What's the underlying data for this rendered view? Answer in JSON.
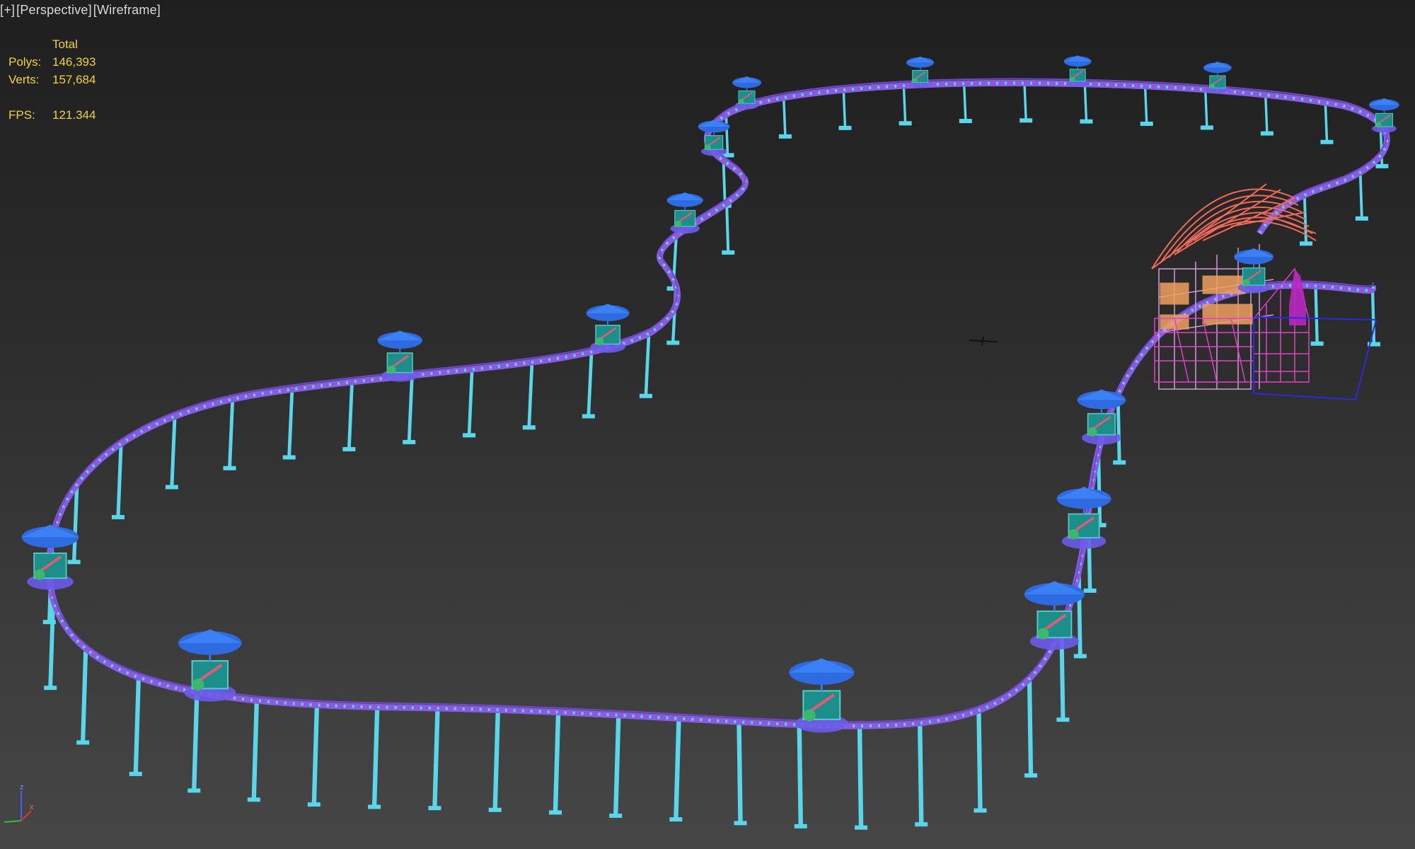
{
  "viewport": {
    "label_parts": [
      "[+]",
      "[Perspective]",
      "[Wireframe]"
    ],
    "view": "Perspective",
    "shading": "Wireframe"
  },
  "stats": {
    "header": "Total",
    "polys_label": "Polys:",
    "polys_value": "146,393",
    "verts_label": "Verts:",
    "verts_value": "157,684",
    "fps_label": "FPS:",
    "fps_value": "121.344"
  },
  "gizmo": {
    "z": "z",
    "x": "x"
  },
  "colors": {
    "track_rail": "#8a5ae0",
    "track_inner": "#5ad8ea",
    "pillar": "#5ad6ea",
    "car_canopy": "#2f6be0",
    "car_body": "#1d8f8a",
    "car_accent": "#e05a7a",
    "station_roof": "#f06a5a",
    "station_frame": "#f0a060",
    "station_magenta": "#e040c8",
    "selection_box": "#2a2ae0",
    "stats_text": "#f0d23c"
  },
  "icons": [
    "viewport-crosshair-icon",
    "axis-gizmo-icon"
  ]
}
